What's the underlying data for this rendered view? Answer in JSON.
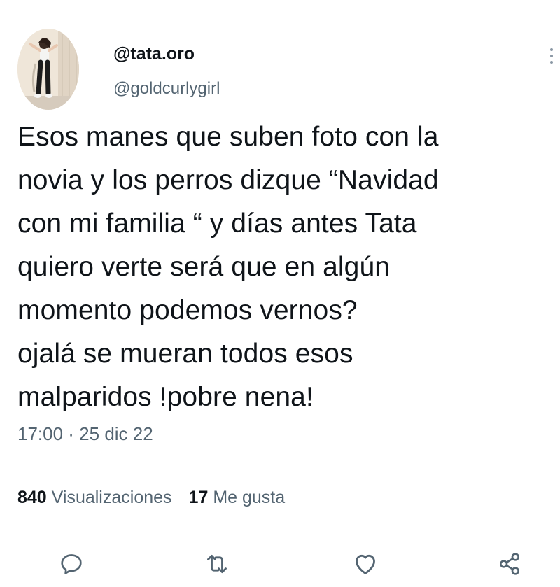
{
  "author": {
    "display_name": "@tata.oro",
    "handle": "@goldcurlygirl",
    "avatar_icon": "profile-photo-avatar"
  },
  "tweet": {
    "text": "Esos manes que suben foto con la\nnovia y los perros dizque “Navidad\ncon mi familia “ y días antes Tata\nquiero verte será que en algún\nmomento podemos vernos?\nojalá se mueran todos esos\nmalparidos !pobre nena!",
    "timestamp": "17:00 · 25 dic 22"
  },
  "stats": {
    "views_count": "840",
    "views_label": "Visualizaciones",
    "likes_count": "17",
    "likes_label": "Me gusta"
  },
  "actions": {
    "reply_icon": "reply-icon",
    "retweet_icon": "retweet-icon",
    "like_icon": "heart-icon",
    "share_icon": "share-icon"
  },
  "colors": {
    "text_primary": "#0f1419",
    "text_secondary": "#536471",
    "divider": "#eff3f4",
    "icon": "#536471"
  }
}
